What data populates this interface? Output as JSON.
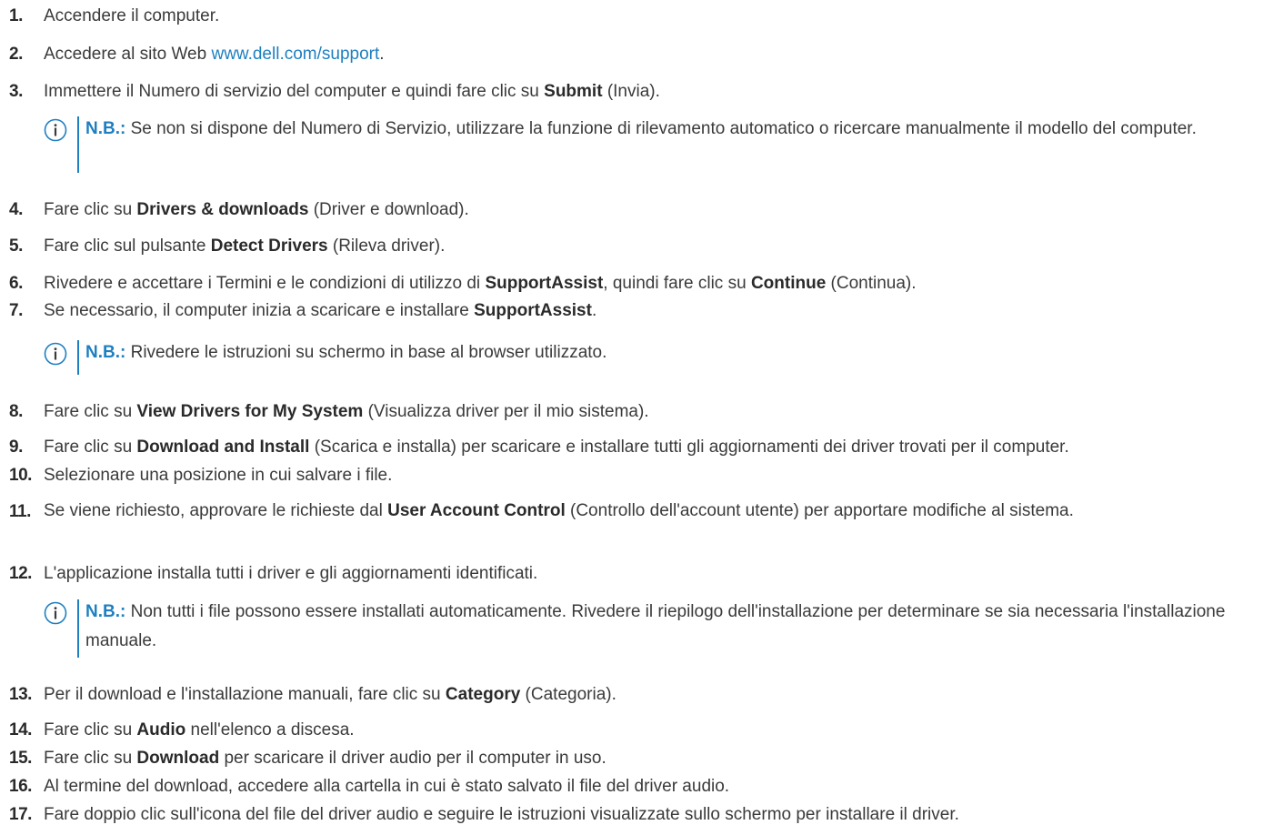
{
  "steps": [
    {
      "n": "1.",
      "parts": [
        "Accendere il computer."
      ]
    },
    {
      "n": "2.",
      "parts": [
        "Accedere al sito Web ",
        "www.dell.com/support",
        "."
      ]
    },
    {
      "n": "3.",
      "parts": [
        "Immettere il Numero di servizio del computer e quindi fare clic su ",
        "Submit",
        " (Invia)."
      ]
    },
    {
      "n": "4.",
      "parts": [
        "Fare clic su ",
        "Drivers & downloads",
        " (Driver e download)."
      ]
    },
    {
      "n": "5.",
      "parts": [
        "Fare clic sul pulsante ",
        "Detect Drivers",
        " (Rileva driver)."
      ]
    },
    {
      "n": "6.",
      "parts": [
        "Rivedere e accettare i Termini e le condizioni di utilizzo di ",
        "SupportAssist",
        ", quindi fare clic su ",
        "Continue",
        " (Continua)."
      ]
    },
    {
      "n": "7.",
      "parts": [
        "Se necessario, il computer inizia a scaricare e installare ",
        "SupportAssist",
        "."
      ]
    },
    {
      "n": "8.",
      "parts": [
        "Fare clic su ",
        "View Drivers for My System",
        " (Visualizza driver per il mio sistema)."
      ]
    },
    {
      "n": "9.",
      "parts": [
        "Fare clic su ",
        "Download and Install",
        " (Scarica e installa) per scaricare e installare tutti gli aggiornamenti dei driver trovati per il computer."
      ]
    },
    {
      "n": "10.",
      "parts": [
        "Selezionare una posizione in cui salvare i file."
      ]
    },
    {
      "n": "11.",
      "parts": [
        "Se viene richiesto, approvare le richieste dal ",
        "User Account Control",
        " (Controllo dell'account utente) per apportare modifiche al sistema."
      ]
    },
    {
      "n": "12.",
      "parts": [
        "L'applicazione installa tutti i driver e gli aggiornamenti identificati."
      ]
    },
    {
      "n": "13.",
      "parts": [
        "Per il download e l'installazione manuali, fare clic su ",
        "Category",
        " (Categoria)."
      ]
    },
    {
      "n": "14.",
      "parts": [
        "Fare clic su ",
        "Audio",
        " nell'elenco a discesa."
      ]
    },
    {
      "n": "15.",
      "parts": [
        "Fare clic su ",
        "Download",
        " per scaricare il driver audio per il computer in uso."
      ]
    },
    {
      "n": "16.",
      "parts": [
        "Al termine del download, accedere alla cartella in cui è stato salvato il file del driver audio."
      ]
    },
    {
      "n": "17.",
      "parts": [
        "Fare doppio clic sull'icona del file del driver audio e seguire le istruzioni visualizzate sullo schermo per installare il driver."
      ]
    }
  ],
  "notes": [
    {
      "label": "N.B.:",
      "text": " Se non si dispone del Numero di Servizio, utilizzare la funzione di rilevamento automatico o ricercare manualmente il modello del computer."
    },
    {
      "label": "N.B.:",
      "text": " Rivedere le istruzioni su schermo in base al browser utilizzato."
    },
    {
      "label": "N.B.:",
      "text": " Non tutti i file possono essere installati automaticamente. Rivedere il riepilogo dell'installazione per determinare se sia necessaria l'installazione manuale."
    }
  ],
  "colors": {
    "accent": "#1e7fc1",
    "text": "#3a3a3a"
  },
  "icon": "info-circle-icon"
}
